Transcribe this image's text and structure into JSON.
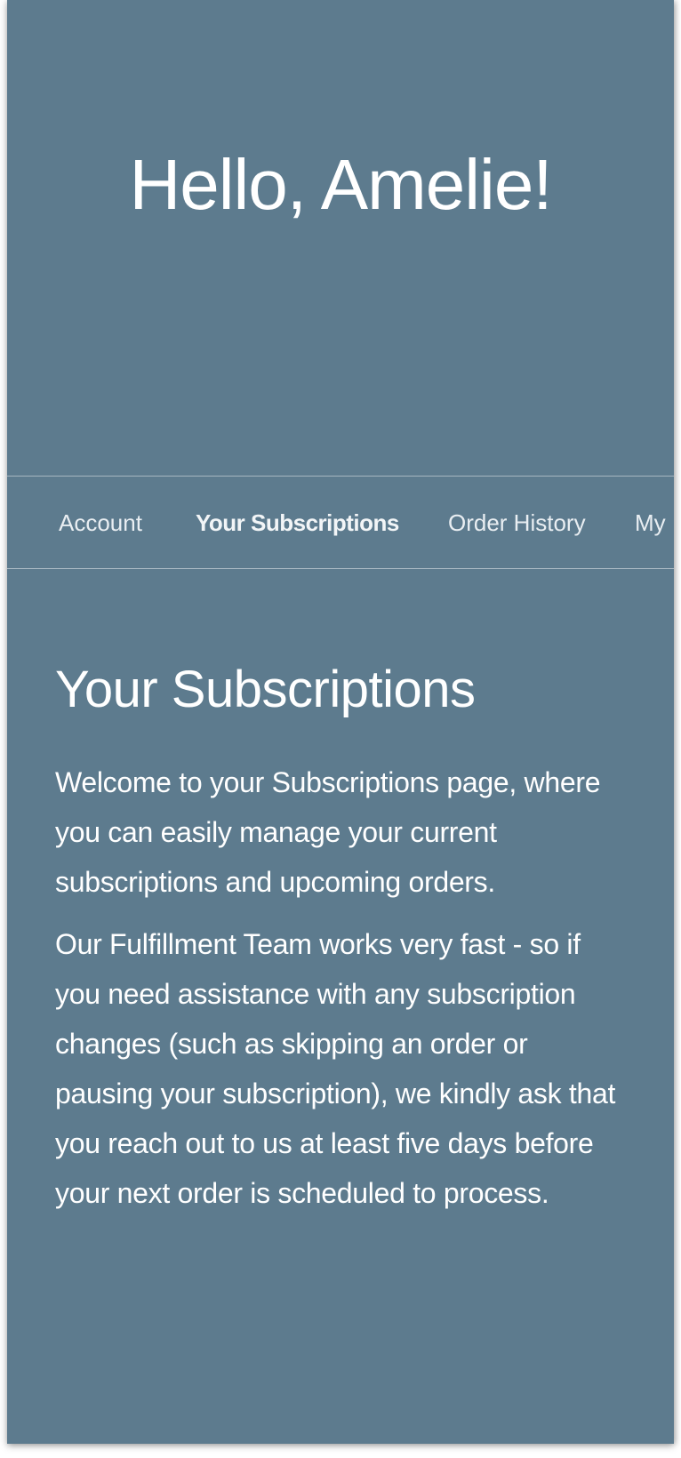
{
  "hero": {
    "greeting": "Hello, Amelie!"
  },
  "nav": {
    "items": [
      {
        "label": "Account",
        "active": false
      },
      {
        "label": "Your Subscriptions",
        "active": true
      },
      {
        "label": "Order History",
        "active": false
      },
      {
        "label": "My",
        "active": false
      }
    ]
  },
  "main": {
    "title": "Your Subscriptions",
    "paragraphs": [
      "Welcome to your Subscriptions page, where you can easily manage your current subscriptions and upcoming orders.",
      "Our Fulfillment Team works very fast - so if you need assistance with any subscription changes (such as skipping an order or pausing your subscription), we kindly ask that you reach out to us at least five days before your next order is scheduled to process."
    ]
  },
  "colors": {
    "background": "#5d7b8e",
    "text": "#ffffff"
  }
}
